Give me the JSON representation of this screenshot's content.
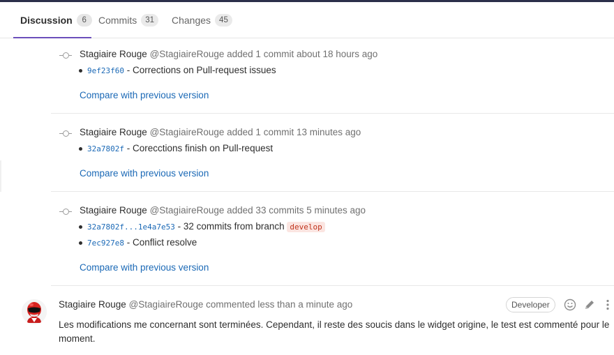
{
  "tabs": [
    {
      "label": "Discussion",
      "count": "6"
    },
    {
      "label": "Commits",
      "count": "31"
    },
    {
      "label": "Changes",
      "count": "45"
    }
  ],
  "notes": [
    {
      "author": "Stagiaire Rouge",
      "username": "@StagiaireRouge",
      "action": "added 1 commit about 18 hours ago",
      "commits": [
        {
          "sha": "9ef23f60",
          "message": "- Corrections on Pull-request issues"
        }
      ],
      "compare_label": "Compare with previous version"
    },
    {
      "author": "Stagiaire Rouge",
      "username": "@StagiaireRouge",
      "action": "added 1 commit 13 minutes ago",
      "commits": [
        {
          "sha": "32a7802f",
          "message": "- Corecctions finish on Pull-request"
        }
      ],
      "compare_label": "Compare with previous version"
    },
    {
      "author": "Stagiaire Rouge",
      "username": "@StagiaireRouge",
      "action": "added 33 commits 5 minutes ago",
      "commits": [
        {
          "sha": "32a7802f...1e4a7e53",
          "message": "- 32 commits from branch",
          "branch": "develop"
        },
        {
          "sha": "7ec927e8",
          "message": "- Conflict resolve"
        }
      ],
      "compare_label": "Compare with previous version"
    }
  ],
  "comment": {
    "author": "Stagiaire Rouge",
    "username": "@StagiaireRouge",
    "action": "commented less than a minute ago",
    "role": "Developer",
    "body": "Les modifications me concernant sont terminées. Cependant, il reste des soucis dans le widget origine, le test est commenté pour le moment."
  },
  "colors": {
    "accent": "#6b4fbb",
    "link": "#1b69b6",
    "branch_text": "#c0341d",
    "branch_bg": "#fbe5e1"
  },
  "icons": {
    "commit": "commit-icon",
    "emoji": "smiley-icon",
    "edit": "pencil-icon",
    "more": "ellipsis-vertical-icon"
  }
}
